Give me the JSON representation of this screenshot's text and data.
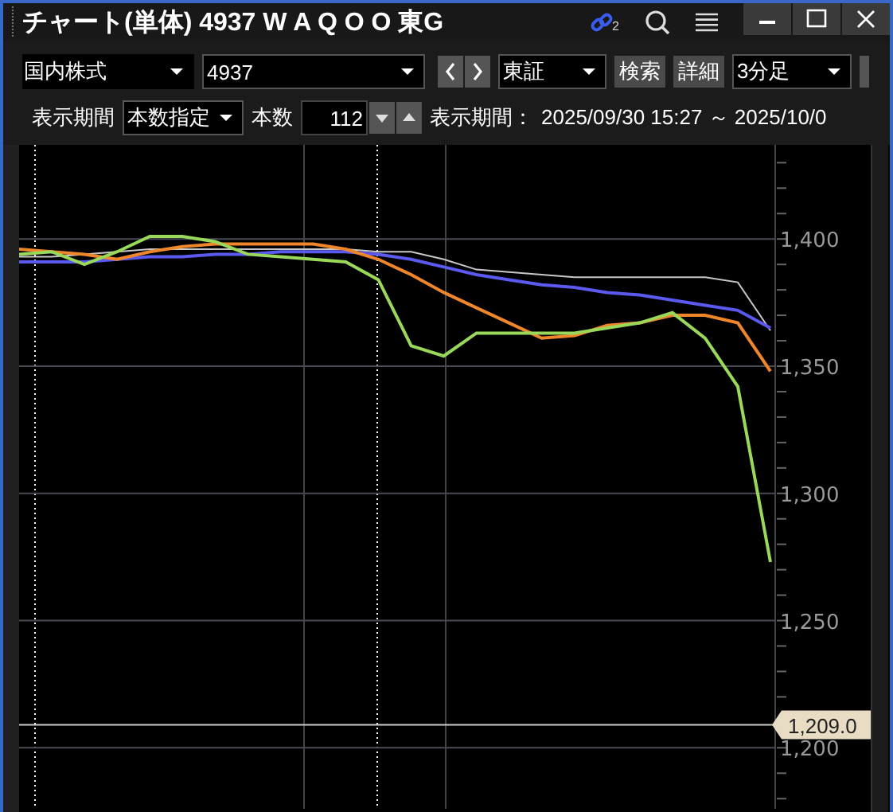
{
  "window": {
    "title": "チャート(単体) 4937 W A Q O O 東G",
    "link_count": "2"
  },
  "toolbar": {
    "market": "国内株式",
    "code": "4937",
    "exchange": "東証",
    "buttons": [
      "検索",
      "詳細"
    ],
    "interval": "3分足"
  },
  "period_bar": {
    "label": "表示期間",
    "mode": "本数指定",
    "count_label": "本数",
    "count": "112",
    "range_label": "表示期間：",
    "range": "2025/09/30 15:27 ～ 2025/10/0"
  },
  "chart": {
    "chart_data": {
      "type": "line",
      "grid": true,
      "ylim": [
        1176,
        1437
      ],
      "yticks": [
        {
          "value": 1200,
          "label": "1,200"
        },
        {
          "value": 1250,
          "label": "1,250"
        },
        {
          "value": 1300,
          "label": "1,300"
        },
        {
          "value": 1350,
          "label": "1,350"
        },
        {
          "value": 1400,
          "label": "1,400"
        }
      ],
      "series": [
        {
          "color": "#c8c8c8",
          "values": [
            1393,
            1393,
            1394,
            1395,
            1396,
            1396,
            1396,
            1396,
            1396,
            1396,
            1396,
            1395,
            1395,
            1392,
            1388,
            1387,
            1386,
            1385,
            1385,
            1385,
            1385,
            1385,
            1383,
            1364
          ]
        },
        {
          "color": "#5a5af0",
          "values": [
            1391,
            1391,
            1391,
            1392,
            1393,
            1393,
            1394,
            1394,
            1395,
            1395,
            1395,
            1394,
            1392,
            1389,
            1386,
            1384,
            1382,
            1381,
            1379,
            1378,
            1376,
            1374,
            1372,
            1365
          ]
        },
        {
          "color": "#f0862a",
          "values": [
            1396,
            1395,
            1394,
            1392,
            1395,
            1397,
            1398,
            1398,
            1398,
            1398,
            1396,
            1392,
            1386,
            1379,
            1373,
            1367,
            1361,
            1362,
            1366,
            1367,
            1370,
            1370,
            1367,
            1348
          ]
        },
        {
          "color": "#9ad85a",
          "values": [
            1394,
            1395,
            1390,
            1395,
            1401,
            1401,
            1399,
            1394,
            1393,
            1392,
            1391,
            1384,
            1358,
            1354,
            1363,
            1363,
            1363,
            1363,
            1365,
            1367,
            1371,
            1361,
            1342,
            1273
          ]
        }
      ],
      "ref_lines": [
        {
          "axis": "y",
          "value": 1209,
          "label": "1,209.0"
        }
      ]
    }
  }
}
